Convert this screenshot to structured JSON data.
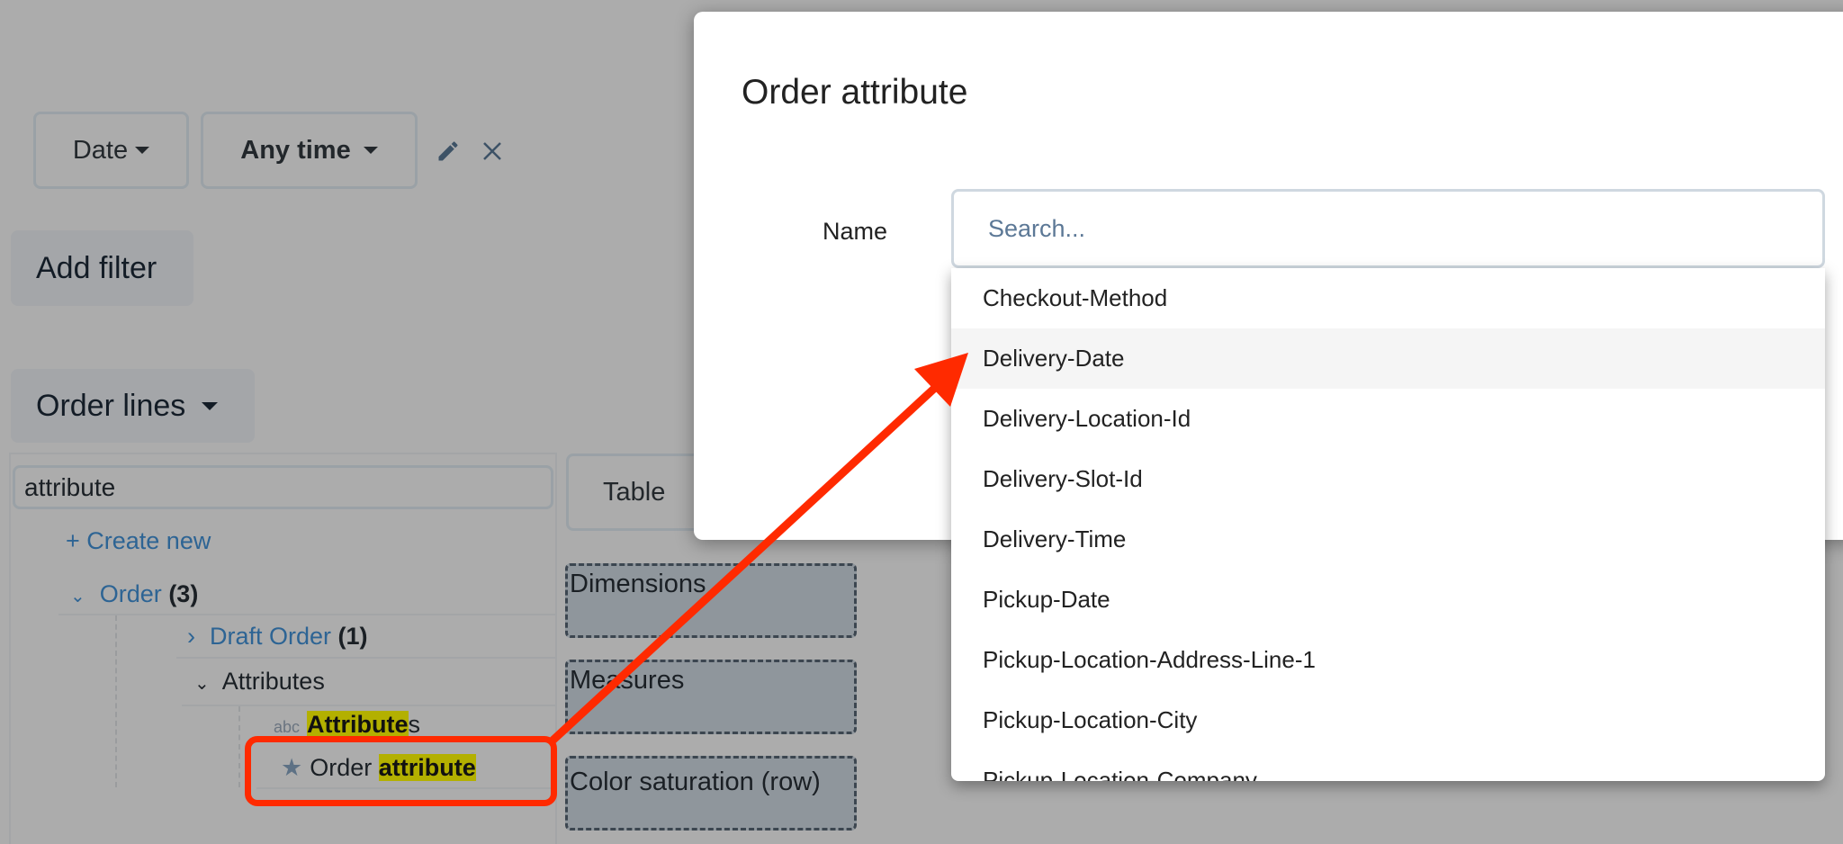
{
  "filters": {
    "field_label": "Date",
    "range_label": "Any time",
    "edit_icon": "pencil-icon",
    "remove_icon": "close-icon"
  },
  "add_filter_label": "Add filter",
  "source_label": "Order lines",
  "field_search": {
    "value": "attribute"
  },
  "tree": {
    "create_new": "+ Create new",
    "order": {
      "label": "Order",
      "count": "(3)"
    },
    "draft_order": {
      "label": "Draft Order",
      "count": "(1)"
    },
    "attributes_group": "Attributes",
    "attr_item": {
      "type": "abc",
      "highlight": "Attribute",
      "rest": "s"
    },
    "order_attr_item": {
      "prefix": "Order ",
      "highlight": "attribute"
    }
  },
  "viz": {
    "table_label": "Table",
    "dimensions": "Dimensions",
    "measures": "Measures",
    "color_saturation": "Color saturation (row)"
  },
  "modal": {
    "title": "Order attribute",
    "name_label": "Name",
    "search_placeholder": "Search...",
    "options": [
      "Checkout-Method",
      "Delivery-Date",
      "Delivery-Location-Id",
      "Delivery-Slot-Id",
      "Delivery-Time",
      "Pickup-Date",
      "Pickup-Location-Address-Line-1",
      "Pickup-Location-City",
      "Pickup-Location-Company"
    ],
    "highlighted_option": "Delivery-Date"
  },
  "colors": {
    "annotation": "#ff2a00",
    "highlight": "#b3b000",
    "link": "#2d6494"
  }
}
